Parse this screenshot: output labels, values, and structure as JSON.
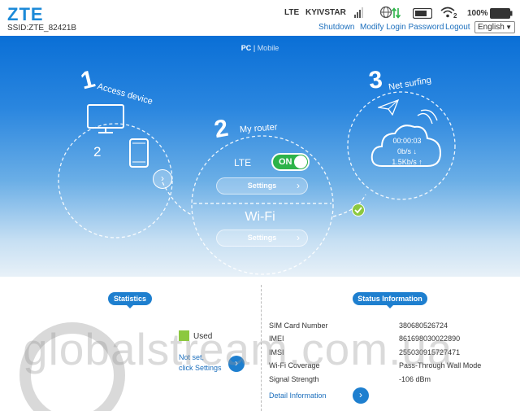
{
  "header": {
    "logo": "ZTE",
    "ssid": "SSID:ZTE_82421B",
    "network_type": "LTE",
    "carrier": "KYIVSTAR",
    "wifi_clients": "2",
    "battery": "100%",
    "links": {
      "shutdown": "Shutdown",
      "modify_password": "Modify Login Password",
      "logout": "Logout"
    },
    "language": "English"
  },
  "view_switch": {
    "pc": "PC",
    "sep": "|",
    "mobile": "Mobile"
  },
  "steps": {
    "access": {
      "num": "1",
      "title": "Access device",
      "count": "2"
    },
    "router": {
      "num": "2",
      "title": "My router",
      "lte_label": "LTE",
      "toggle": "ON",
      "lte_settings": "Settings",
      "wifi_label": "Wi-Fi",
      "wifi_settings": "Settings"
    },
    "surfing": {
      "num": "3",
      "title": "Net surfing",
      "duration": "00:00:03",
      "download": "0b/s ↓",
      "upload": "1.5Kb/s ↑"
    }
  },
  "statistics": {
    "tag": "Statistics",
    "used": "Used",
    "not_set_1": "Not set,",
    "not_set_2": "click Settings"
  },
  "status": {
    "tag": "Status Information",
    "rows": [
      {
        "key": "SIM Card Number",
        "value": "380680526724"
      },
      {
        "key": "IMEI",
        "value": "861698030022890"
      },
      {
        "key": "IMSI",
        "value": "255030915727471"
      },
      {
        "key": "Wi-Fi Coverage",
        "value": "Pass-Through Wall Mode"
      },
      {
        "key": "Signal Strength",
        "value": "-106 dBm"
      }
    ],
    "detail": "Detail Information"
  },
  "watermark": "globalstream.com.ua",
  "colors": {
    "accent": "#1e7fcf",
    "toggle_on": "#2db34a",
    "used": "#8cc83f"
  }
}
